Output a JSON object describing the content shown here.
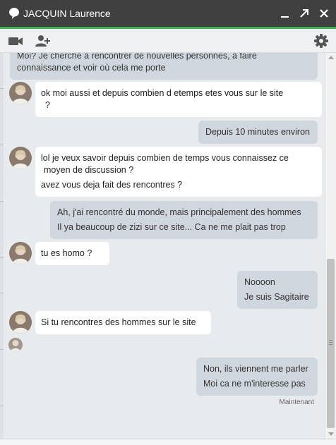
{
  "window": {
    "title": "JACQUIN Laurence",
    "minimize_icon": "minimize-icon",
    "popout_icon": "popout-icon",
    "close_icon": "close-icon"
  },
  "toolbar": {
    "video_icon": "video-camera-icon",
    "add_person_icon": "add-person-icon",
    "settings_icon": "gear-icon"
  },
  "colors": {
    "titlebar": "#404040",
    "accent": "#3fb34f",
    "sent_bubble": "#cfd6dd",
    "received_bubble": "#ffffff",
    "background": "#e8ebee"
  },
  "messages": [
    {
      "direction": "sent",
      "lines": [
        "Moi? Je cherche à rencontrer de nouvelles personnes, à faire",
        "connaissance et voir où cela me porte"
      ]
    },
    {
      "direction": "received",
      "lines": [
        "ok  moi aussi  et  depuis combien d etemps etes  vous sur  le site",
        "?"
      ]
    },
    {
      "direction": "sent",
      "lines": [
        "Depuis 10 minutes environ"
      ]
    },
    {
      "direction": "received",
      "lines": [
        "lol  je veux savoir depuis combien de temps vous connaissez ce",
        "moyen de discussion ?",
        "avez vous deja fait des  rencontres  ?"
      ]
    },
    {
      "direction": "sent",
      "lines": [
        "Ah, j'ai rencontré du monde, mais principalement des hommes",
        "Il ya  beaucoup de zizi sur ce site... Ca ne me plait pas trop"
      ]
    },
    {
      "direction": "received",
      "lines": [
        "tu  es  homo  ?"
      ]
    },
    {
      "direction": "sent",
      "lines": [
        "Noooon",
        "Je suis Sagitaire"
      ]
    },
    {
      "direction": "received",
      "lines": [
        "Si tu rencontres des hommes sur le site"
      ]
    },
    {
      "direction": "sent",
      "lines": [
        "Non, ils viennent me parler",
        "Moi ca ne m'interesse pas"
      ]
    }
  ],
  "timestamp": "Maintenant"
}
